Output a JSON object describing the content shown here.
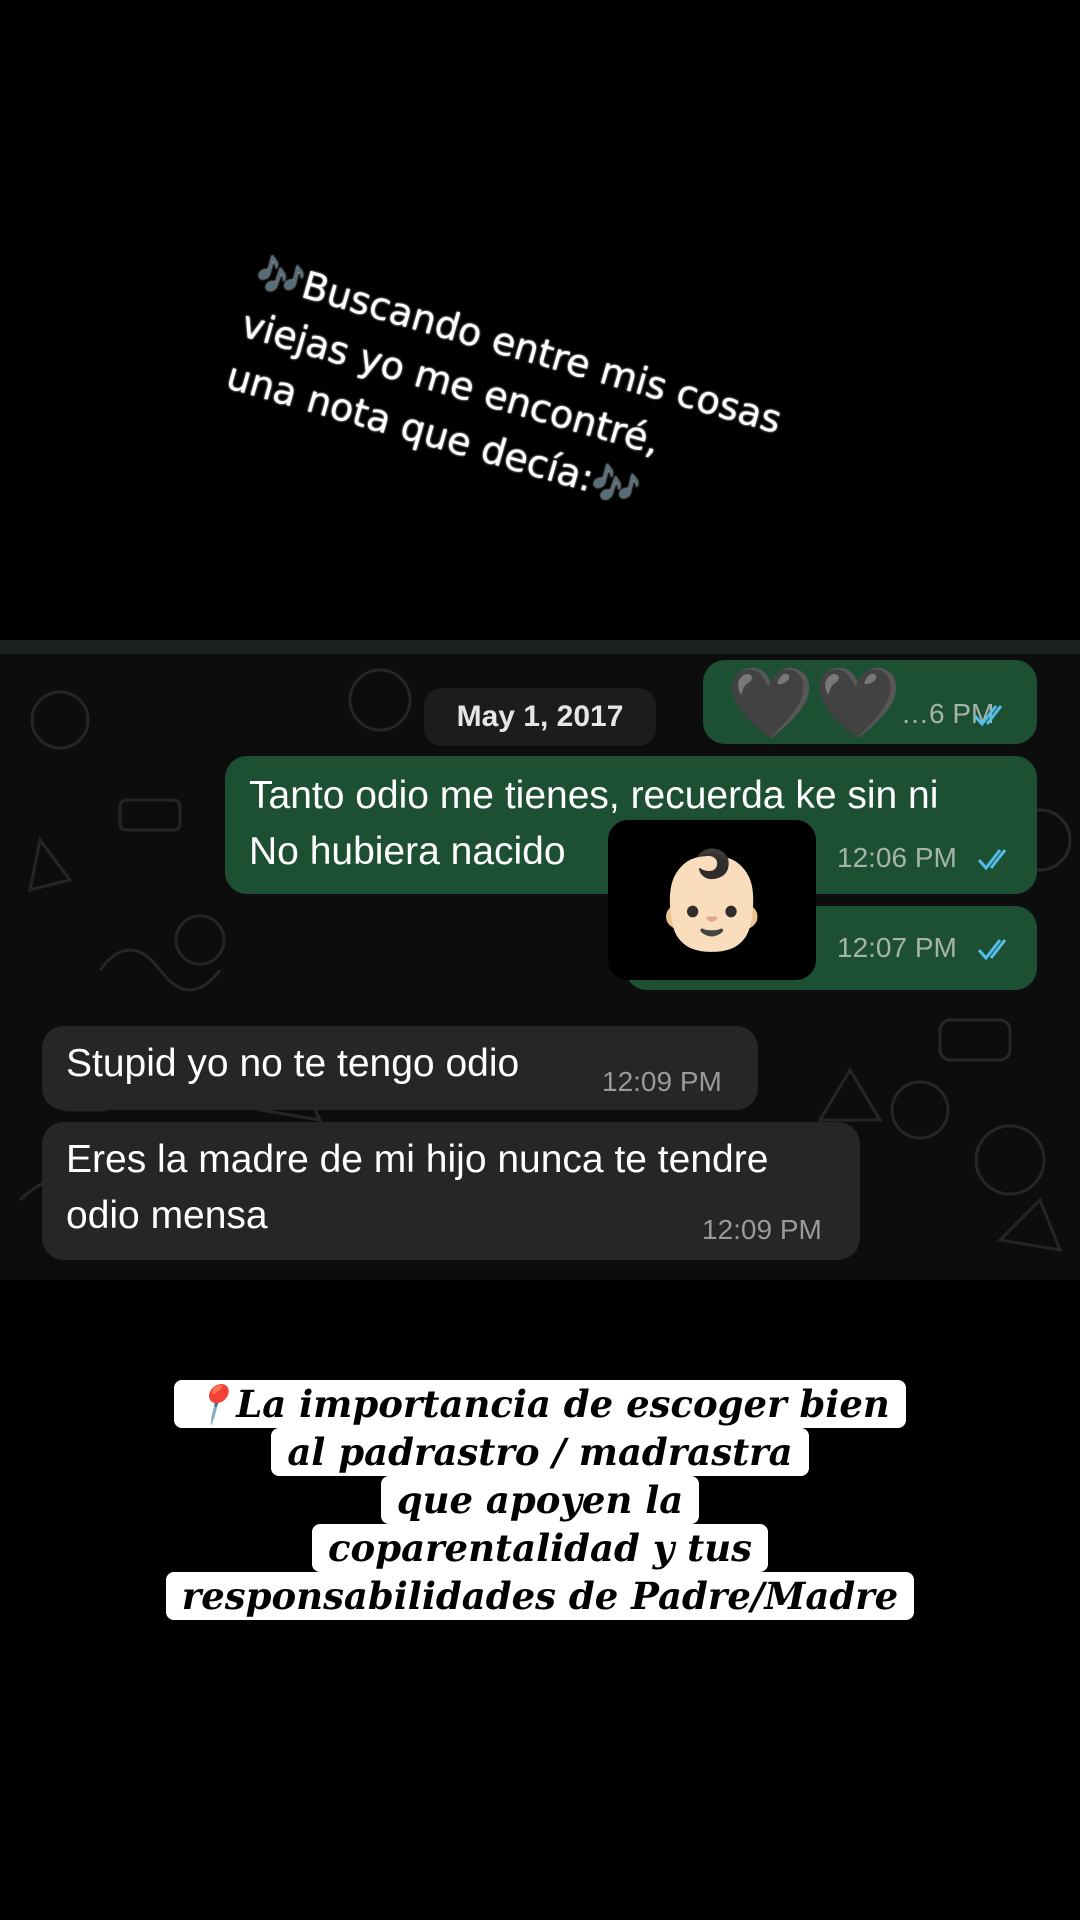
{
  "top_caption": "🎶Buscando entre mis cosas\nviejas yo me encontré,\nuna nota que decía:🎶",
  "chat": {
    "date": "May 1, 2017",
    "messages": [
      {
        "from": "me",
        "content": "🖤🖤",
        "time": "…6 PM",
        "status": "read"
      },
      {
        "from": "me",
        "content": "Tanto odio me tienes, recuerda ke sin ni\nNo hubiera nacido",
        "time": "12:06 PM",
        "status": "read"
      },
      {
        "from": "me",
        "content": "👶🏻",
        "time": "12:07 PM",
        "status": "read"
      },
      {
        "from": "them",
        "content": "Stupid yo no te tengo odio",
        "time": "12:09 PM"
      },
      {
        "from": "them",
        "content": "Eres la madre de mi hijo nunca te tendre\nodio mensa",
        "time": "12:09 PM"
      }
    ]
  },
  "bottom_caption": {
    "lines": [
      "📍La importancia de escoger bien",
      "al padrastro / madrastra",
      "que apoyen la",
      "coparentalidad y tus",
      "responsabilidades de Padre/Madre"
    ]
  },
  "colors": {
    "outgoing_bubble": "#1d5033",
    "incoming_bubble": "#262626",
    "read_ticks": "#53bdeb",
    "background": "#000000"
  }
}
